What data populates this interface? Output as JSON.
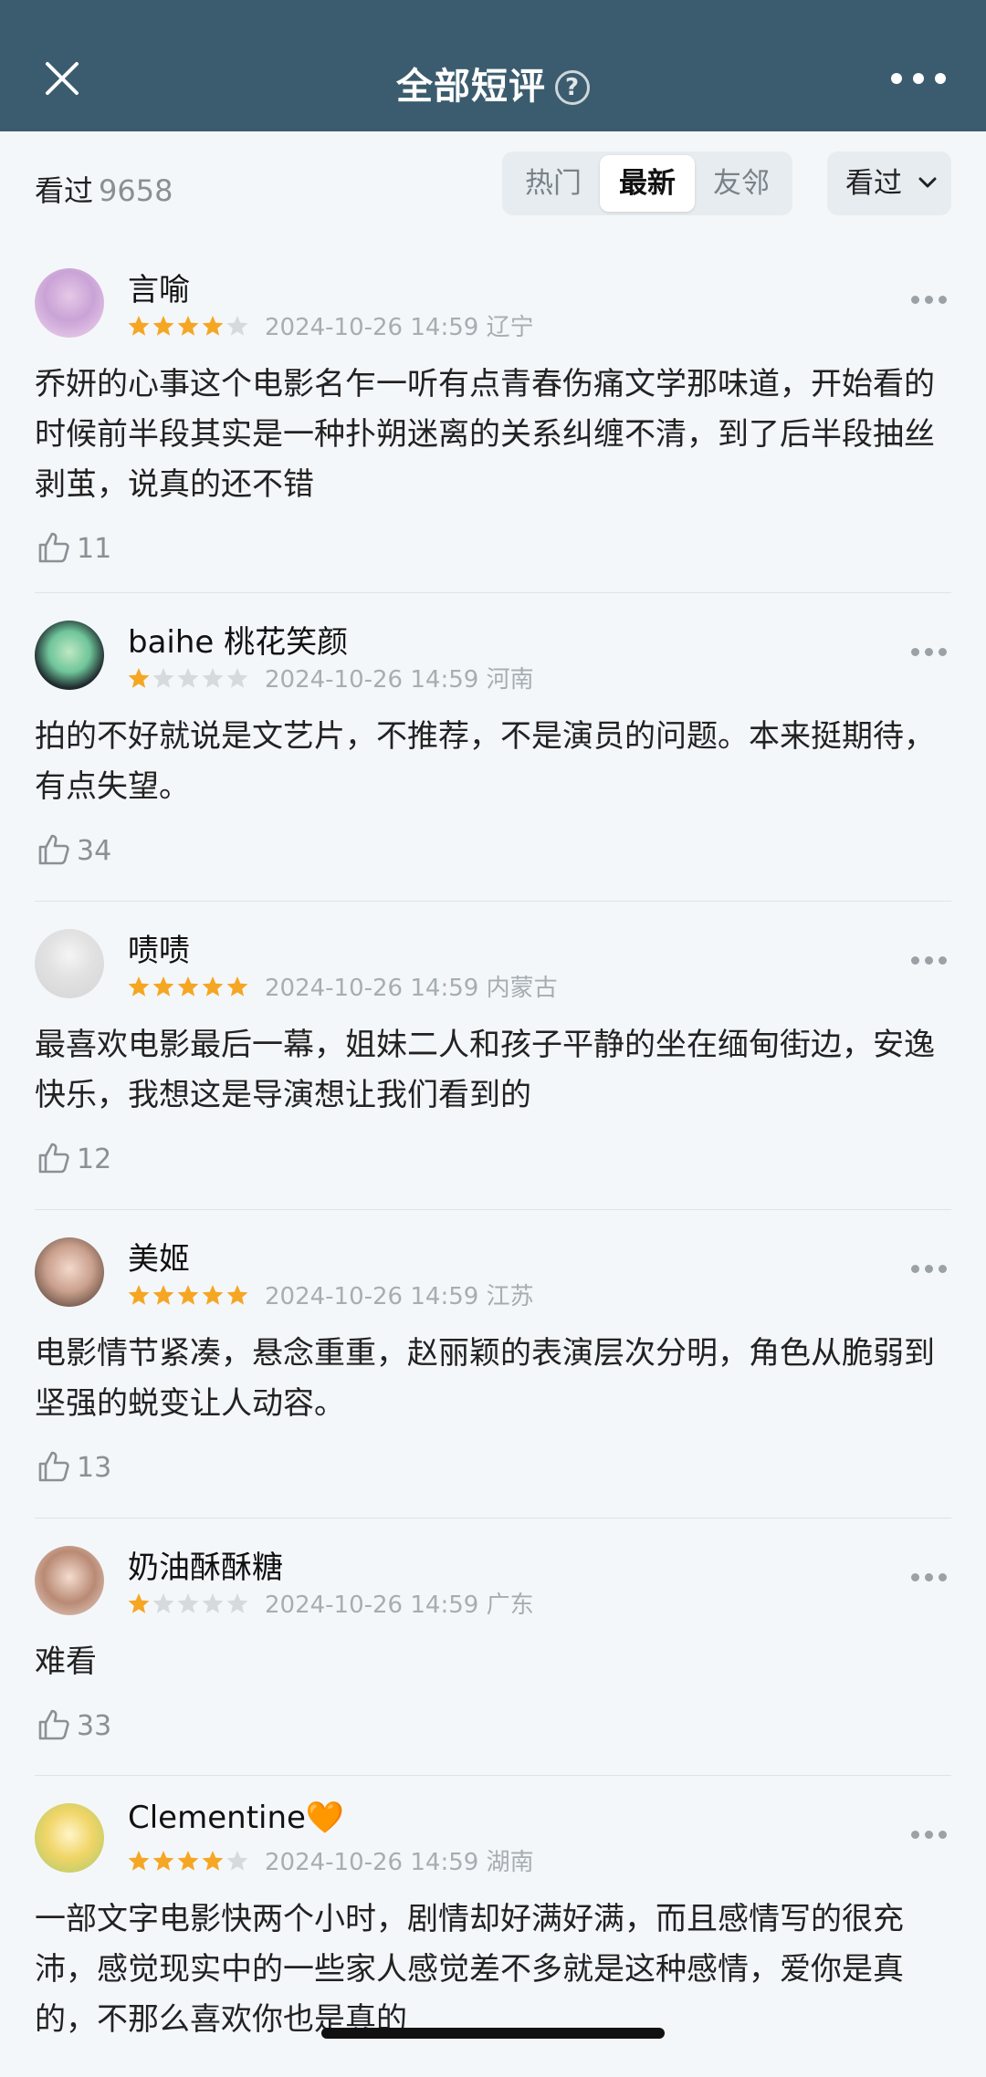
{
  "header": {
    "title": "全部短评",
    "help_glyph": "?",
    "close_icon": "close-icon",
    "more_icon": "more-icon"
  },
  "filters": {
    "watched_label": "看过",
    "watched_count": "9658",
    "tabs": [
      "热门",
      "最新",
      "友邻"
    ],
    "selected_tab": "最新",
    "status_dropdown": "看过"
  },
  "colors": {
    "header_bg": "#3b5c6e",
    "star_filled": "#f5a623",
    "star_empty": "#d6dadd"
  },
  "reviews": [
    {
      "user": "言喻",
      "rating": 4,
      "time": "2024-10-26 14:59",
      "location": "辽宁",
      "text": "乔妍的心事这个电影名乍一听有点青春伤痛文学那味道，开始看的时候前半段其实是一种扑朔迷离的关系纠缠不清，到了后半段抽丝剥茧，说真的还不错",
      "likes": "11"
    },
    {
      "user": "baihe 桃花笑颜",
      "rating": 1,
      "time": "2024-10-26 14:59",
      "location": "河南",
      "text": "拍的不好就说是文艺片，不推荐，不是演员的问题。本来挺期待，有点失望。",
      "likes": "34"
    },
    {
      "user": "啧啧",
      "rating": 5,
      "time": "2024-10-26 14:59",
      "location": "内蒙古",
      "text": "最喜欢电影最后一幕，姐妹二人和孩子平静的坐在缅甸街边，安逸快乐，我想这是导演想让我们看到的",
      "likes": "12"
    },
    {
      "user": "美姬",
      "rating": 5,
      "time": "2024-10-26 14:59",
      "location": "江苏",
      "text": "电影情节紧凑，悬念重重，赵丽颖的表演层次分明，角色从脆弱到坚强的蜕变让人动容。",
      "likes": "13"
    },
    {
      "user": "奶油酥酥糖",
      "rating": 1,
      "time": "2024-10-26 14:59",
      "location": "广东",
      "text": "难看",
      "likes": "33"
    },
    {
      "user": "Clementine🧡",
      "rating": 4,
      "time": "2024-10-26 14:59",
      "location": "湖南",
      "text": "一部文字电影快两个小时，剧情却好满好满，而且感情写的很充沛，感觉现实中的一些家人感觉差不多就是这种感情，爱你是真的，不那么喜欢你也是真的",
      "likes": ""
    }
  ]
}
